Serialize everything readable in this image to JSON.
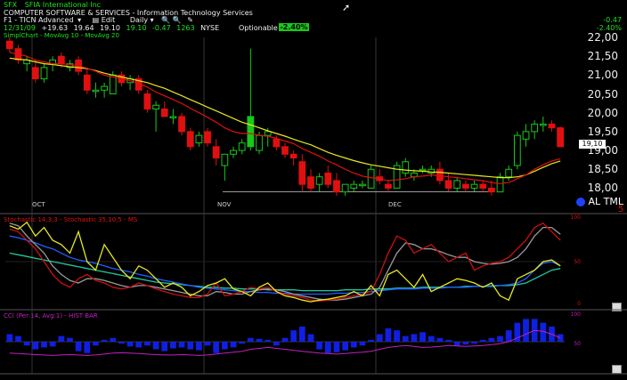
{
  "header": {
    "ticker": "SFX",
    "company": "SFIA International Inc",
    "sector": "COMPUTER SOFTWARE & SERVICES - Information Technology Services",
    "tab_label": "F1 - TICN Advanced",
    "edit_label": "Edit",
    "period_label": "Daily",
    "quote_date": "12/31/09",
    "quote_open": "+19.63",
    "quote_high": "19.64",
    "quote_low": "19.10",
    "quote_last": "19.10",
    "quote_change": "-0.47",
    "quote_volume": "1263",
    "quote_exchange": "NYSE",
    "optionable_label": "Optionable",
    "change_pct_box": "-2.40%",
    "top_right_change": "-0.47",
    "top_right_pct": "-2.40%"
  },
  "price_panel": {
    "title": "SimplChart - MovAvg 10 - MovAvg 20",
    "axis_labels": [
      "22,00",
      "21,50",
      "21,00",
      "20,50",
      "20,00",
      "19,50",
      "19,00",
      "18,50",
      "18,00"
    ],
    "last_price_tag": "19,10",
    "corner_labels": "AL TML",
    "corner_number": "5",
    "month_labels": [
      "OCT",
      "NOV",
      "DEC"
    ]
  },
  "stoch_panel": {
    "title": "Stochastic 14,3,3 - Stochastic 35,10,5 - MS",
    "axis_labels": [
      "100",
      "50",
      "0"
    ]
  },
  "cci_panel": {
    "title": "CCI (Per:14, Avg:1) - HIST BAR",
    "axis_labels": [
      "100",
      "50"
    ]
  },
  "colors": {
    "background": "#000000",
    "up_candle": "#19c819",
    "down_candle": "#e01010",
    "ma10": "#e01010",
    "ma20": "#e8e81e",
    "stoch_fast": "#cc1010",
    "stoch_slow": "#999999",
    "stoch_ms": "#e8e81e",
    "stoch_blue": "#2060ff",
    "stoch_teal": "#20c8a0",
    "cci_bar": "#1020e0",
    "cci_line": "#c020c0"
  },
  "chart_data": [
    {
      "type": "candlestick",
      "panel": "price",
      "ylim": [
        17.75,
        22.0
      ],
      "x_labels": [
        "OCT",
        "NOV",
        "DEC"
      ],
      "candles": [
        {
          "o": 21.9,
          "h": 22.0,
          "l": 21.6,
          "c": 21.7
        },
        {
          "o": 21.7,
          "h": 21.8,
          "l": 21.3,
          "c": 21.4
        },
        {
          "o": 21.3,
          "h": 21.5,
          "l": 21.1,
          "c": 21.4
        },
        {
          "o": 21.2,
          "h": 21.4,
          "l": 20.8,
          "c": 20.9
        },
        {
          "o": 20.9,
          "h": 21.3,
          "l": 20.8,
          "c": 21.2
        },
        {
          "o": 21.3,
          "h": 21.5,
          "l": 21.1,
          "c": 21.4
        },
        {
          "o": 21.5,
          "h": 21.6,
          "l": 21.2,
          "c": 21.3
        },
        {
          "o": 21.2,
          "h": 21.4,
          "l": 21.1,
          "c": 21.3
        },
        {
          "o": 21.4,
          "h": 21.5,
          "l": 21.0,
          "c": 21.1
        },
        {
          "o": 21.0,
          "h": 21.2,
          "l": 20.5,
          "c": 20.6
        },
        {
          "o": 20.6,
          "h": 20.8,
          "l": 20.4,
          "c": 20.6
        },
        {
          "o": 20.6,
          "h": 20.8,
          "l": 20.4,
          "c": 20.7
        },
        {
          "o": 20.5,
          "h": 21.1,
          "l": 20.5,
          "c": 21.0
        },
        {
          "o": 21.0,
          "h": 21.1,
          "l": 20.7,
          "c": 20.8
        },
        {
          "o": 20.8,
          "h": 21.0,
          "l": 20.6,
          "c": 20.9
        },
        {
          "o": 20.9,
          "h": 21.0,
          "l": 20.5,
          "c": 20.6
        },
        {
          "o": 20.5,
          "h": 20.6,
          "l": 20.0,
          "c": 20.1
        },
        {
          "o": 20.1,
          "h": 20.3,
          "l": 19.5,
          "c": 20.2
        },
        {
          "o": 20.1,
          "h": 20.3,
          "l": 19.9,
          "c": 19.9
        },
        {
          "o": 19.9,
          "h": 20.1,
          "l": 19.7,
          "c": 19.9
        },
        {
          "o": 19.9,
          "h": 20.0,
          "l": 19.4,
          "c": 19.5
        },
        {
          "o": 19.5,
          "h": 19.6,
          "l": 19.0,
          "c": 19.1
        },
        {
          "o": 19.2,
          "h": 19.5,
          "l": 19.1,
          "c": 19.4
        },
        {
          "o": 19.5,
          "h": 19.6,
          "l": 19.1,
          "c": 19.2
        },
        {
          "o": 19.1,
          "h": 19.3,
          "l": 18.6,
          "c": 18.8
        },
        {
          "o": 18.6,
          "h": 18.9,
          "l": 18.2,
          "c": 18.9
        },
        {
          "o": 18.9,
          "h": 19.1,
          "l": 18.8,
          "c": 19.0
        },
        {
          "o": 19.0,
          "h": 19.3,
          "l": 18.9,
          "c": 19.2
        },
        {
          "o": 19.1,
          "h": 21.7,
          "l": 19.0,
          "c": 19.9
        },
        {
          "o": 19.0,
          "h": 19.5,
          "l": 18.9,
          "c": 19.4
        },
        {
          "o": 19.4,
          "h": 19.6,
          "l": 19.1,
          "c": 19.5
        },
        {
          "o": 19.3,
          "h": 19.4,
          "l": 19.0,
          "c": 19.1
        },
        {
          "o": 19.1,
          "h": 19.2,
          "l": 18.8,
          "c": 18.9
        },
        {
          "o": 18.9,
          "h": 19.0,
          "l": 18.6,
          "c": 18.8
        },
        {
          "o": 18.7,
          "h": 18.9,
          "l": 17.9,
          "c": 18.1
        },
        {
          "o": 18.3,
          "h": 18.5,
          "l": 17.9,
          "c": 18.0
        },
        {
          "o": 18.1,
          "h": 18.4,
          "l": 17.9,
          "c": 18.3
        },
        {
          "o": 18.4,
          "h": 18.6,
          "l": 18.0,
          "c": 18.1
        },
        {
          "o": 18.2,
          "h": 18.4,
          "l": 17.8,
          "c": 17.9
        },
        {
          "o": 17.9,
          "h": 18.1,
          "l": 17.8,
          "c": 18.1
        },
        {
          "o": 18.0,
          "h": 18.2,
          "l": 17.9,
          "c": 18.1
        },
        {
          "o": 18.1,
          "h": 18.2,
          "l": 18.0,
          "c": 18.1
        },
        {
          "o": 18.0,
          "h": 18.6,
          "l": 18.0,
          "c": 18.5
        },
        {
          "o": 18.3,
          "h": 18.5,
          "l": 18.1,
          "c": 18.2
        },
        {
          "o": 18.1,
          "h": 18.2,
          "l": 17.9,
          "c": 18.0
        },
        {
          "o": 18.0,
          "h": 18.7,
          "l": 18.0,
          "c": 18.6
        },
        {
          "o": 18.4,
          "h": 18.8,
          "l": 18.3,
          "c": 18.7
        },
        {
          "o": 18.3,
          "h": 18.5,
          "l": 18.2,
          "c": 18.4
        },
        {
          "o": 18.5,
          "h": 18.6,
          "l": 18.4,
          "c": 18.5
        },
        {
          "o": 18.4,
          "h": 18.6,
          "l": 18.3,
          "c": 18.5
        },
        {
          "o": 18.5,
          "h": 18.7,
          "l": 18.1,
          "c": 18.2
        },
        {
          "o": 18.2,
          "h": 18.4,
          "l": 17.9,
          "c": 18.0
        },
        {
          "o": 18.0,
          "h": 18.3,
          "l": 17.9,
          "c": 18.2
        },
        {
          "o": 18.1,
          "h": 18.2,
          "l": 17.9,
          "c": 18.0
        },
        {
          "o": 18.0,
          "h": 18.2,
          "l": 17.9,
          "c": 18.1
        },
        {
          "o": 18.1,
          "h": 18.2,
          "l": 17.9,
          "c": 18.0
        },
        {
          "o": 18.0,
          "h": 18.2,
          "l": 17.8,
          "c": 17.9
        },
        {
          "o": 17.9,
          "h": 18.4,
          "l": 17.9,
          "c": 18.3
        },
        {
          "o": 18.3,
          "h": 18.6,
          "l": 18.2,
          "c": 18.5
        },
        {
          "o": 18.6,
          "h": 19.5,
          "l": 18.5,
          "c": 19.4
        },
        {
          "o": 19.3,
          "h": 19.7,
          "l": 19.1,
          "c": 19.5
        },
        {
          "o": 19.5,
          "h": 19.8,
          "l": 19.3,
          "c": 19.7
        },
        {
          "o": 19.7,
          "h": 19.9,
          "l": 19.5,
          "c": 19.7
        },
        {
          "o": 19.7,
          "h": 19.8,
          "l": 19.5,
          "c": 19.6
        },
        {
          "o": 19.6,
          "h": 19.64,
          "l": 19.1,
          "c": 19.1
        }
      ],
      "ma10": [
        21.6,
        21.55,
        21.5,
        21.4,
        21.35,
        21.3,
        21.3,
        21.28,
        21.25,
        21.18,
        21.1,
        21.0,
        20.95,
        20.9,
        20.85,
        20.78,
        20.68,
        20.55,
        20.45,
        20.35,
        20.25,
        20.12,
        20.0,
        19.88,
        19.75,
        19.6,
        19.5,
        19.45,
        19.45,
        19.4,
        19.38,
        19.32,
        19.25,
        19.18,
        19.05,
        18.95,
        18.85,
        18.72,
        18.62,
        18.5,
        18.4,
        18.32,
        18.28,
        18.25,
        18.2,
        18.22,
        18.25,
        18.3,
        18.32,
        18.35,
        18.33,
        18.3,
        18.28,
        18.25,
        18.22,
        18.2,
        18.15,
        18.12,
        18.15,
        18.25,
        18.35,
        18.5,
        18.62,
        18.72,
        18.78
      ],
      "ma20": [
        21.45,
        21.42,
        21.4,
        21.35,
        21.3,
        21.28,
        21.25,
        21.22,
        21.2,
        21.17,
        21.12,
        21.05,
        21.0,
        20.95,
        20.9,
        20.85,
        20.8,
        20.72,
        20.65,
        20.55,
        20.45,
        20.35,
        20.25,
        20.15,
        20.05,
        19.95,
        19.85,
        19.75,
        19.68,
        19.6,
        19.52,
        19.45,
        19.38,
        19.3,
        19.22,
        19.15,
        19.05,
        18.95,
        18.87,
        18.8,
        18.73,
        18.67,
        18.62,
        18.58,
        18.54,
        18.5,
        18.48,
        18.46,
        18.45,
        18.43,
        18.42,
        18.4,
        18.38,
        18.36,
        18.34,
        18.32,
        18.3,
        18.28,
        18.28,
        18.3,
        18.35,
        18.45,
        18.55,
        18.65,
        18.72
      ]
    },
    {
      "type": "line",
      "panel": "stochastic",
      "ylim": [
        0,
        100
      ],
      "series": [
        {
          "key": "fast",
          "values": [
            88,
            85,
            75,
            65,
            50,
            35,
            25,
            20,
            30,
            35,
            28,
            25,
            20,
            18,
            20,
            25,
            22,
            18,
            15,
            12,
            10,
            8,
            8,
            12,
            25,
            10,
            12,
            15,
            20,
            18,
            20,
            15,
            12,
            10,
            8,
            5,
            4,
            5,
            6,
            8,
            10,
            12,
            15,
            35,
            60,
            80,
            75,
            60,
            65,
            70,
            60,
            50,
            55,
            60,
            40,
            45,
            48,
            50,
            55,
            65,
            75,
            90,
            95,
            85,
            75
          ]
        },
        {
          "key": "slow",
          "values": [
            95,
            92,
            80,
            70,
            60,
            45,
            35,
            28,
            25,
            30,
            30,
            28,
            25,
            22,
            20,
            22,
            22,
            20,
            18,
            16,
            14,
            12,
            10,
            10,
            15,
            14,
            12,
            12,
            15,
            17,
            18,
            17,
            15,
            12,
            10,
            8,
            6,
            5,
            5,
            6,
            8,
            10,
            12,
            20,
            40,
            60,
            72,
            70,
            65,
            65,
            62,
            58,
            55,
            55,
            50,
            48,
            47,
            48,
            50,
            55,
            65,
            80,
            90,
            90,
            82
          ]
        },
        {
          "key": "ms",
          "values": [
            92,
            88,
            96,
            80,
            90,
            75,
            70,
            60,
            85,
            50,
            40,
            70,
            55,
            40,
            30,
            45,
            40,
            30,
            20,
            25,
            20,
            10,
            15,
            22,
            25,
            30,
            18,
            15,
            10,
            20,
            25,
            15,
            10,
            8,
            5,
            3,
            5,
            6,
            8,
            10,
            15,
            10,
            22,
            10,
            35,
            40,
            30,
            20,
            35,
            15,
            20,
            25,
            30,
            28,
            25,
            20,
            25,
            10,
            5,
            30,
            35,
            40,
            50,
            52,
            45
          ]
        },
        {
          "key": "blue",
          "values": [
            80,
            78,
            75,
            72,
            68,
            65,
            60,
            55,
            52,
            50,
            48,
            45,
            42,
            40,
            38,
            35,
            33,
            30,
            28,
            26,
            24,
            22,
            20,
            19,
            18,
            17,
            16,
            15,
            15,
            14,
            14,
            13,
            13,
            12,
            12,
            12,
            12,
            12,
            13,
            13,
            14,
            14,
            15,
            16,
            17,
            18,
            18,
            18,
            19,
            19,
            19,
            20,
            20,
            20,
            21,
            21,
            22,
            22,
            23,
            25,
            30,
            40,
            48,
            50,
            45
          ]
        },
        {
          "key": "teal",
          "values": [
            60,
            58,
            56,
            54,
            52,
            50,
            48,
            46,
            44,
            42,
            40,
            38,
            36,
            34,
            32,
            30,
            28,
            26,
            25,
            24,
            23,
            22,
            21,
            20,
            20,
            19,
            19,
            18,
            18,
            18,
            17,
            17,
            17,
            17,
            16,
            16,
            16,
            16,
            16,
            17,
            17,
            17,
            18,
            18,
            18,
            19,
            19,
            19,
            20,
            20,
            20,
            20,
            20,
            21,
            21,
            21,
            21,
            22,
            22,
            23,
            25,
            30,
            35,
            40,
            42
          ]
        }
      ]
    },
    {
      "type": "bar",
      "panel": "cci",
      "ylim": [
        -150,
        150
      ],
      "baseline": 0,
      "values": [
        40,
        30,
        -20,
        -40,
        -30,
        -25,
        30,
        20,
        -50,
        -60,
        -20,
        10,
        20,
        -10,
        -25,
        -30,
        -20,
        -40,
        -50,
        -35,
        -30,
        -40,
        -45,
        -20,
        -60,
        -40,
        -30,
        -10,
        20,
        15,
        10,
        -20,
        20,
        60,
        80,
        40,
        -40,
        -60,
        -55,
        -45,
        -30,
        -20,
        10,
        40,
        70,
        60,
        30,
        40,
        50,
        30,
        20,
        10,
        -20,
        -15,
        -10,
        10,
        20,
        30,
        60,
        100,
        120,
        120,
        100,
        80,
        40
      ],
      "line": [
        -60,
        -62,
        -65,
        -68,
        -70,
        -72,
        -70,
        -68,
        -70,
        -72,
        -70,
        -65,
        -60,
        -58,
        -60,
        -62,
        -65,
        -68,
        -70,
        -70,
        -68,
        -70,
        -72,
        -70,
        -65,
        -60,
        -55,
        -50,
        -40,
        -35,
        -30,
        -35,
        -40,
        -45,
        -50,
        -55,
        -60,
        -62,
        -65,
        -62,
        -58,
        -55,
        -50,
        -40,
        -30,
        -25,
        -20,
        -25,
        -30,
        -28,
        -25,
        -20,
        -22,
        -25,
        -22,
        -20,
        -15,
        -10,
        0,
        20,
        40,
        60,
        55,
        40,
        20
      ]
    }
  ]
}
